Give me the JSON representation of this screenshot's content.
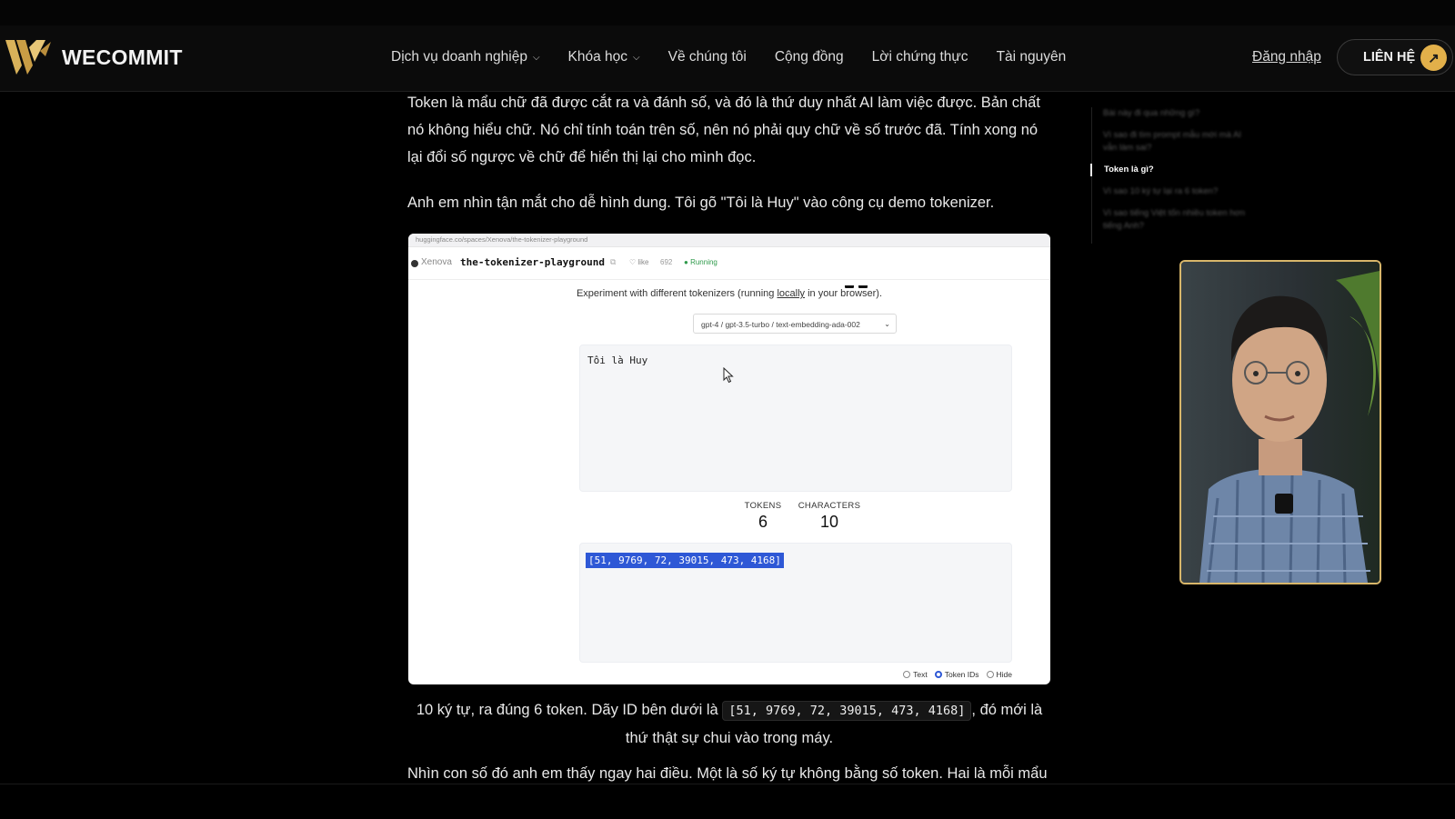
{
  "brand": {
    "name": "WECOMMIT",
    "logo_color": "#d9b25a"
  },
  "nav": {
    "items": [
      {
        "label": "Dịch vụ doanh nghiệp",
        "dropdown": true
      },
      {
        "label": "Khóa học",
        "dropdown": true
      },
      {
        "label": "Về chúng tôi",
        "dropdown": false
      },
      {
        "label": "Cộng đồng",
        "dropdown": false
      },
      {
        "label": "Lời chứng thực",
        "dropdown": false
      },
      {
        "label": "Tài nguyên",
        "dropdown": false
      }
    ],
    "login": "Đăng nhập",
    "contact": "LIÊN HỆ",
    "contact_icon": "arrow-up-right-icon",
    "accent": "#e2b04a"
  },
  "article": {
    "p1": "Token là mẩu chữ đã được cắt ra và đánh số, và đó là thứ duy nhất AI làm việc được. Bản chất nó không hiểu chữ. Nó chỉ tính toán trên số, nên nó phải quy chữ về số trước đã. Tính xong nó lại đổi số ngược về chữ để hiển thị lại cho mình đọc.",
    "p2": "Anh em nhìn tận mắt cho dễ hình dung. Tôi gõ \"Tôi là Huy\" vào công cụ demo tokenizer.",
    "p3_before": "10 ký tự, ra đúng 6 token. Dãy ID bên dưới là ",
    "p3_code": "[51, 9769, 72, 39015, 473, 4168]",
    "p3_after": ", đó mới là thứ thật sự chui vào trong máy.",
    "p4": "Nhìn con số đó anh em thấy ngay hai điều. Một là số ký tự không bằng số token. Hai là mỗi mẩu"
  },
  "screenshot": {
    "url": "huggingface.co/spaces/Xenova/the-tokenizer-playground",
    "owner": "Xenova",
    "repo": "the-tokenizer-playground",
    "like_label": "like",
    "like_count": "692",
    "status": "Running",
    "subtitle_before": "Experiment with different tokenizers (running ",
    "subtitle_link": "locally",
    "subtitle_after": " in your browser).",
    "model_select": "gpt-4 / gpt-3.5-turbo / text-embedding-ada-002",
    "input_text": "Tôi là Huy",
    "tokens_label": "TOKENS",
    "tokens_value": "6",
    "chars_label": "CHARACTERS",
    "chars_value": "10",
    "output_ids": "[51, 9769, 72, 39015, 473, 4168]",
    "view_options": [
      {
        "label": "Text",
        "selected": false
      },
      {
        "label": "Token IDs",
        "selected": true
      },
      {
        "label": "Hide",
        "selected": false
      }
    ],
    "highlight_color": "#2e58d6"
  },
  "toc": {
    "items": [
      {
        "label": "Bài này đi qua những gì?",
        "state": "blur"
      },
      {
        "label": "Vì sao đi tìm prompt mẫu mới mà AI vẫn làm sai?",
        "state": "blur"
      },
      {
        "label": "Token là gì?",
        "state": "active"
      },
      {
        "label": "Vì sao 10 ký tự lại ra 6 token?",
        "state": "blur"
      },
      {
        "label": "Vì sao tiếng Việt tốn nhiều token hơn tiếng Anh?",
        "state": "blur"
      }
    ]
  },
  "video": {
    "frame_color": "#d8b66a"
  }
}
